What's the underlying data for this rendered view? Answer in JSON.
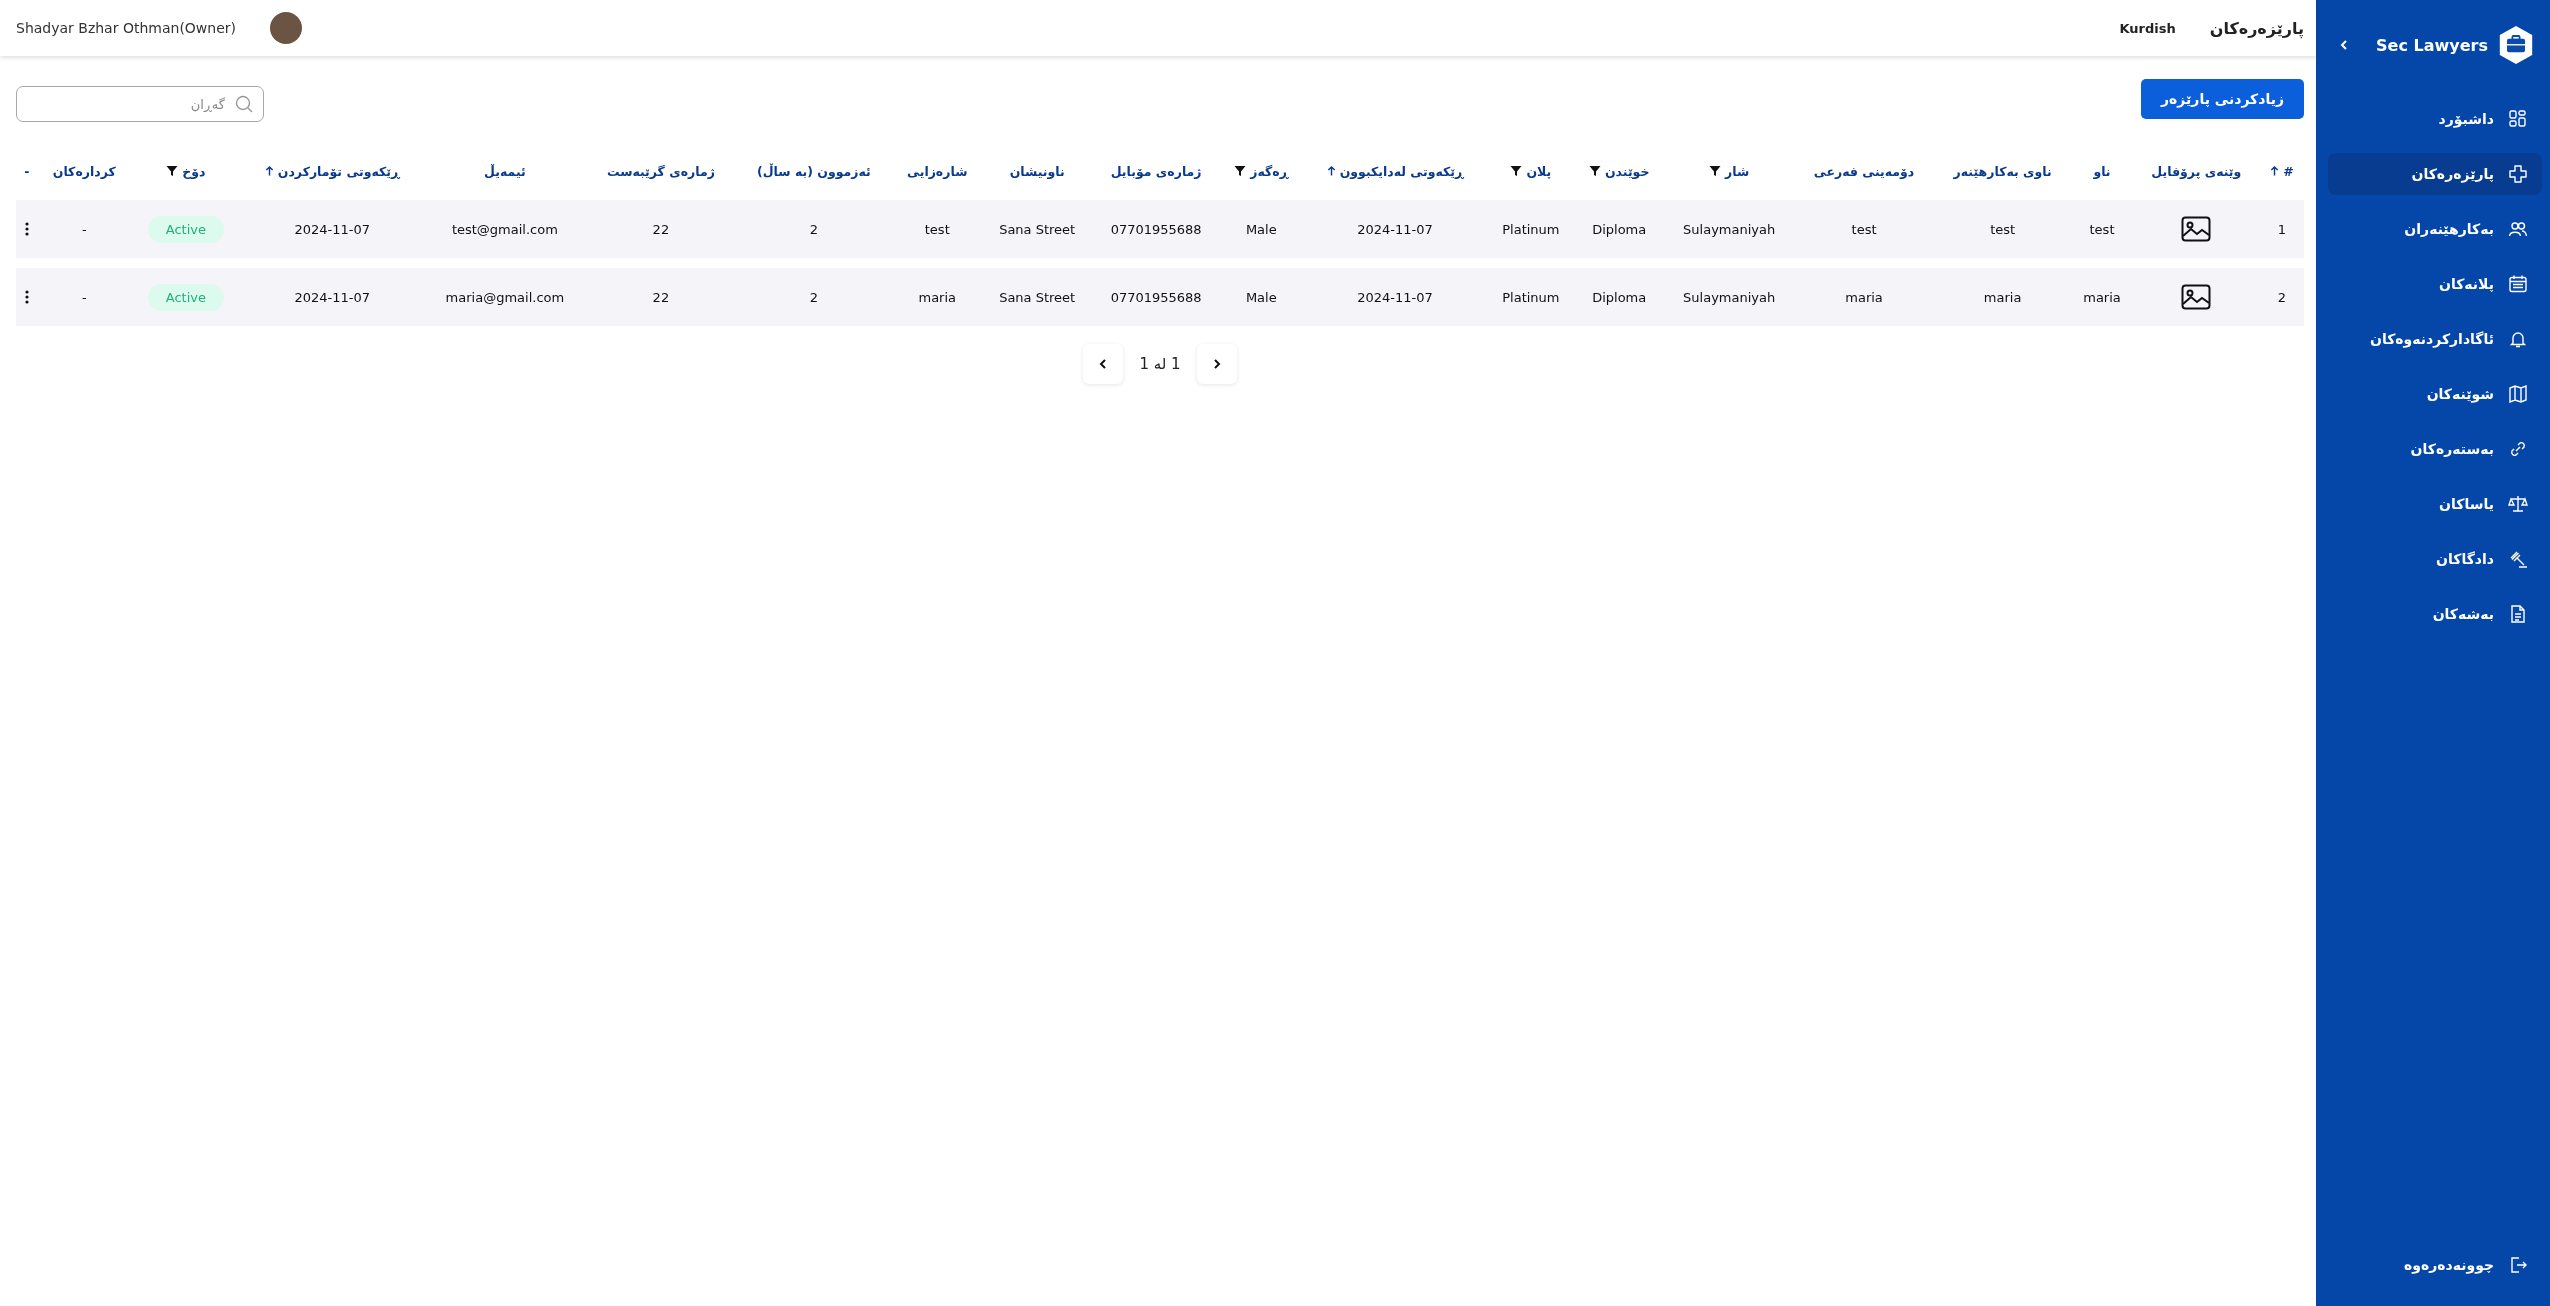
{
  "sidebar": {
    "brand": "Sec Lawyers",
    "items": [
      {
        "label": "داشبۆرد",
        "selected": false
      },
      {
        "label": "پارێزەرەکان",
        "selected": true
      },
      {
        "label": "بەکارهێنەران",
        "selected": false
      },
      {
        "label": "پلانەکان",
        "selected": false
      },
      {
        "label": "ئاگادارکردنەوەکان",
        "selected": false
      },
      {
        "label": "شوێنەکان",
        "selected": false
      },
      {
        "label": "بەستەرەکان",
        "selected": false
      },
      {
        "label": "یاساکان",
        "selected": false
      },
      {
        "label": "دادگاکان",
        "selected": false
      },
      {
        "label": "بەشەکان",
        "selected": false
      }
    ],
    "logout": "چوونەدەرەوە"
  },
  "header": {
    "title": "پارێزەرەکان",
    "language": "Kurdish",
    "user": "Shadyar Bzhar Othman(Owner)"
  },
  "toolbar": {
    "add_button": "زیادکردنی پارێزەر",
    "search": {
      "placeholder": "گەڕان"
    }
  },
  "table": {
    "columns": [
      {
        "label": "#",
        "sortable": true,
        "filterable": false
      },
      {
        "label": "وێنەی پرۆفایل",
        "sortable": false,
        "filterable": false
      },
      {
        "label": "ناو",
        "sortable": false,
        "filterable": false
      },
      {
        "label": "ناوی بەکارهێنەر",
        "sortable": false,
        "filterable": false
      },
      {
        "label": "دۆمەینی فەرعی",
        "sortable": false,
        "filterable": false
      },
      {
        "label": "شار",
        "sortable": false,
        "filterable": true
      },
      {
        "label": "خوێندن",
        "sortable": false,
        "filterable": true
      },
      {
        "label": "پلان",
        "sortable": false,
        "filterable": true
      },
      {
        "label": "ڕێکەوتی لەدایکبوون",
        "sortable": true,
        "filterable": false
      },
      {
        "label": "ڕەگەز",
        "sortable": false,
        "filterable": true
      },
      {
        "label": "ژمارەی مۆبایل",
        "sortable": false,
        "filterable": false
      },
      {
        "label": "ناونیشان",
        "sortable": false,
        "filterable": false
      },
      {
        "label": "شارەزایی",
        "sortable": false,
        "filterable": false
      },
      {
        "label": "ئەزموون (بە ساڵ)",
        "sortable": false,
        "filterable": false
      },
      {
        "label": "ژمارەی گرێبەست",
        "sortable": false,
        "filterable": false
      },
      {
        "label": "ئیمەیڵ",
        "sortable": false,
        "filterable": false
      },
      {
        "label": "ڕێکەوتی تۆمارکردن",
        "sortable": true,
        "filterable": false
      },
      {
        "label": "دۆخ",
        "sortable": false,
        "filterable": true
      },
      {
        "label": "کردارەکان",
        "sortable": false,
        "filterable": false
      },
      {
        "label": "-",
        "sortable": false,
        "filterable": false
      }
    ],
    "rows": [
      {
        "number": "1",
        "name": "test",
        "username": "test",
        "subdomain": "test",
        "city": "Sulaymaniyah",
        "education": "Diploma",
        "plan": "Platinum",
        "birth_date": "2024-11-07",
        "gender": "Male",
        "mobile": "07701955688",
        "address": "Sana Street",
        "expertise": "test",
        "experience": "2",
        "contracts": "22",
        "email": "test@gmail.com",
        "registered": "2024-11-07",
        "status": "Active",
        "actions": "-"
      },
      {
        "number": "2",
        "name": "maria",
        "username": "maria",
        "subdomain": "maria",
        "city": "Sulaymaniyah",
        "education": "Diploma",
        "plan": "Platinum",
        "birth_date": "2024-11-07",
        "gender": "Male",
        "mobile": "07701955688",
        "address": "Sana Street",
        "expertise": "maria",
        "experience": "2",
        "contracts": "22",
        "email": "maria@gmail.com",
        "registered": "2024-11-07",
        "status": "Active",
        "actions": "-"
      }
    ]
  },
  "pagination": {
    "label": "1 لە 1"
  }
}
